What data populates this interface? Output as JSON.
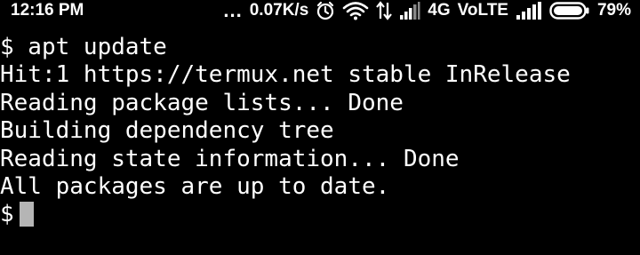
{
  "status_bar": {
    "time": "12:16 PM",
    "more_notifications": "...",
    "net_speed": "0.07K/s",
    "network_type": "4G",
    "volte": "VoLTE",
    "battery_percent": "79%",
    "battery_level": 0.79,
    "icons": [
      "alarm-icon",
      "wifi-icon",
      "data-arrows-icon",
      "signal-icon",
      "signal-icon-2",
      "battery-icon"
    ]
  },
  "terminal": {
    "lines": [
      "$ apt update",
      "Hit:1 https://termux.net stable InRelease",
      "Reading package lists... Done",
      "Building dependency tree",
      "Reading state information... Done",
      "All packages are up to date."
    ],
    "prompt": "$"
  },
  "colors": {
    "background": "#000000",
    "text": "#ffffff",
    "cursor": "#b5b5b5"
  }
}
